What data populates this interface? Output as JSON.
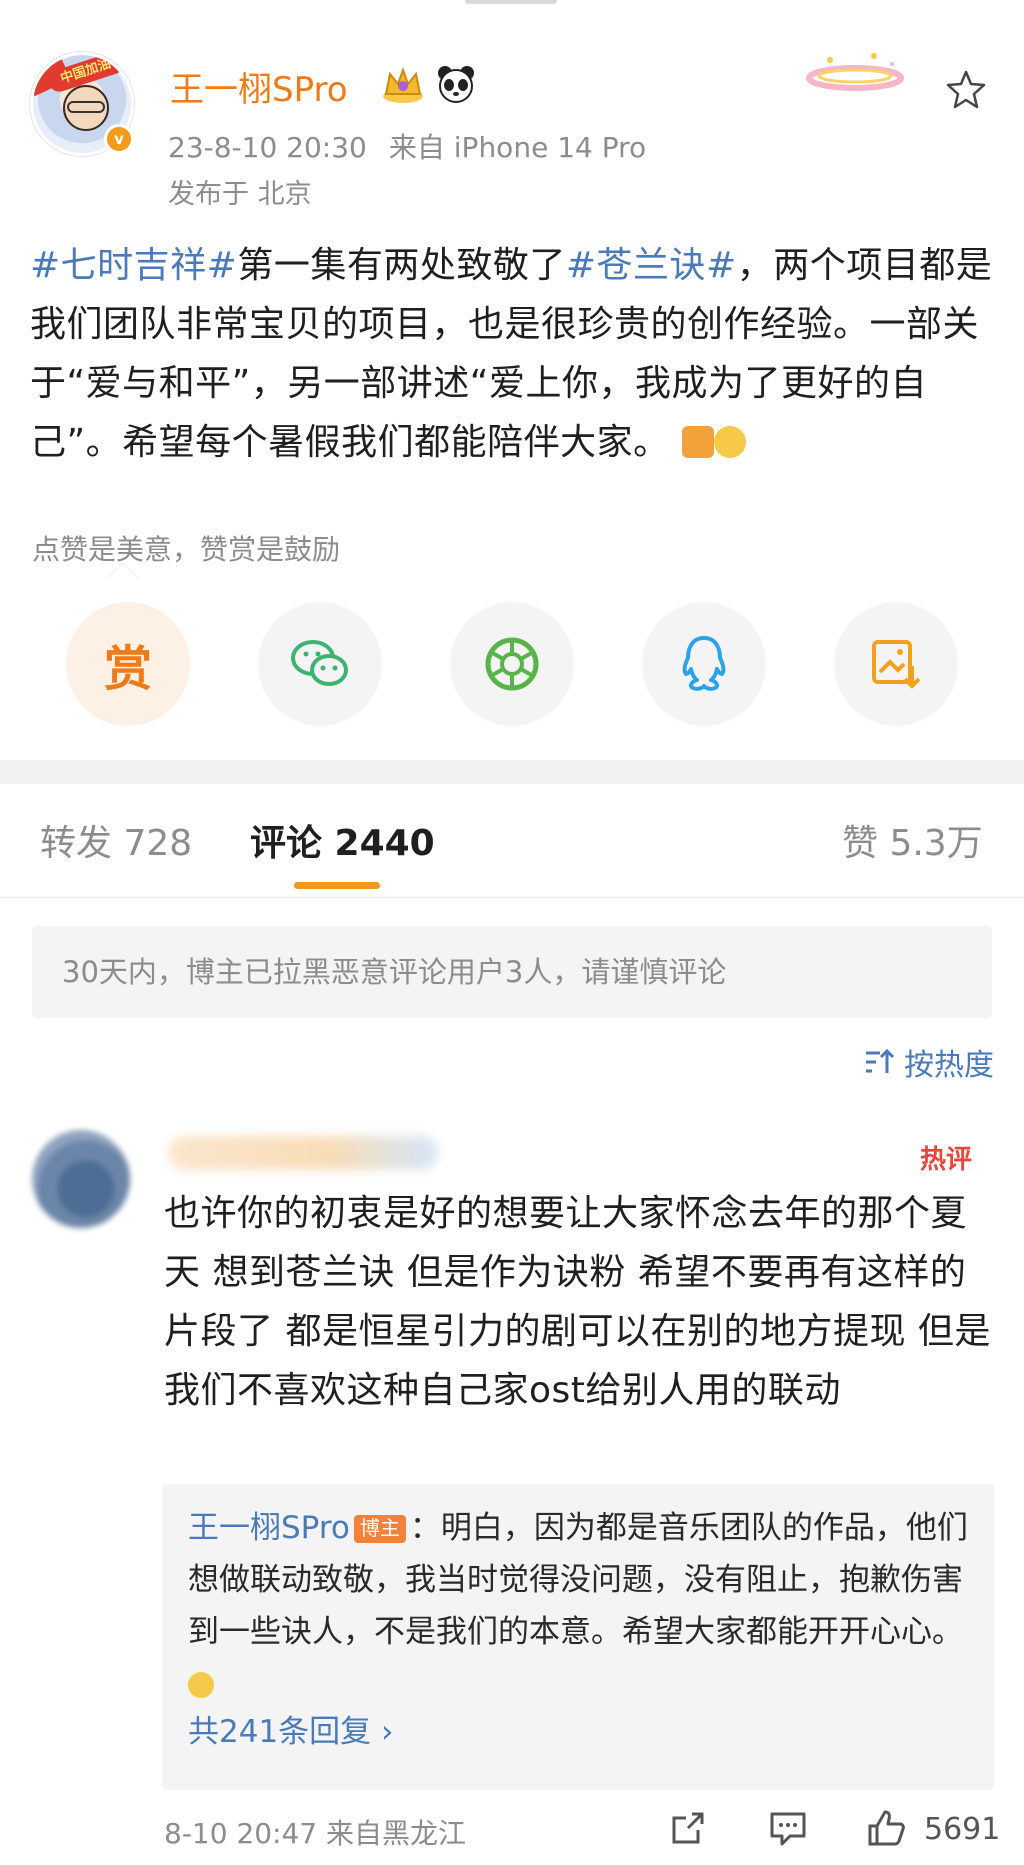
{
  "post": {
    "author": "王一栩SPro",
    "avatar_banner": "中国加油",
    "time": "23-8-10 20:30",
    "source": "来自 iPhone 14 Pro",
    "location": "发布于 北京",
    "text_segments": [
      {
        "text": "#七时吉祥#",
        "tag": true
      },
      {
        "text": "第一集有两处致敬了",
        "tag": false
      },
      {
        "text": "#苍兰诀#",
        "tag": true
      },
      {
        "text": "，两个项目都是我们团队非常宝贝的项目，也是很珍贵的创作经验。一部关于“爱与和平”，另一部讲述“爱上你，我成为了更好的自己”。希望每个暑假我们都能陪伴大家。",
        "tag": false
      }
    ],
    "reward_note": "点赞是美意，赞赏是鼓励",
    "reward_label": "赏"
  },
  "share": {
    "buttons": [
      "reward",
      "wechat-icon",
      "moments-icon",
      "qq-icon",
      "save-image-icon"
    ]
  },
  "tabs": {
    "repost": "转发 728",
    "comments": "评论 2440",
    "likes": "赞 5.3万"
  },
  "notice": "30天内，博主已拉黑恶意评论用户3人，请谨慎评论",
  "sort_label": "按热度",
  "comment": {
    "hot_label": "热评",
    "text": "也许你的初衷是好的想要让大家怀念去年的那个夏天 想到苍兰诀 但是作为诀粉 希望不要再有这样的片段了 都是恒星引力的剧可以在别的地方提现 但是我们不喜欢这种自己家ost给别人用的联动",
    "reply": {
      "name": "王一栩SPro",
      "badge": "博主",
      "text": "：明白，因为都是音乐团队的作品，他们想做联动致敬，我当时觉得没问题，没有阻止，抱歉伤害到一些诀人，不是我们的本意。希望大家都能开开心心。",
      "count_label": "共241条回复 ›"
    },
    "time": "8-10 20:47 来自黑龙江",
    "likes": "5691"
  },
  "colors": {
    "accent_orange": "#ef7a18",
    "link_blue": "#4a7ab8",
    "muted_gray": "#8c8c8c"
  }
}
